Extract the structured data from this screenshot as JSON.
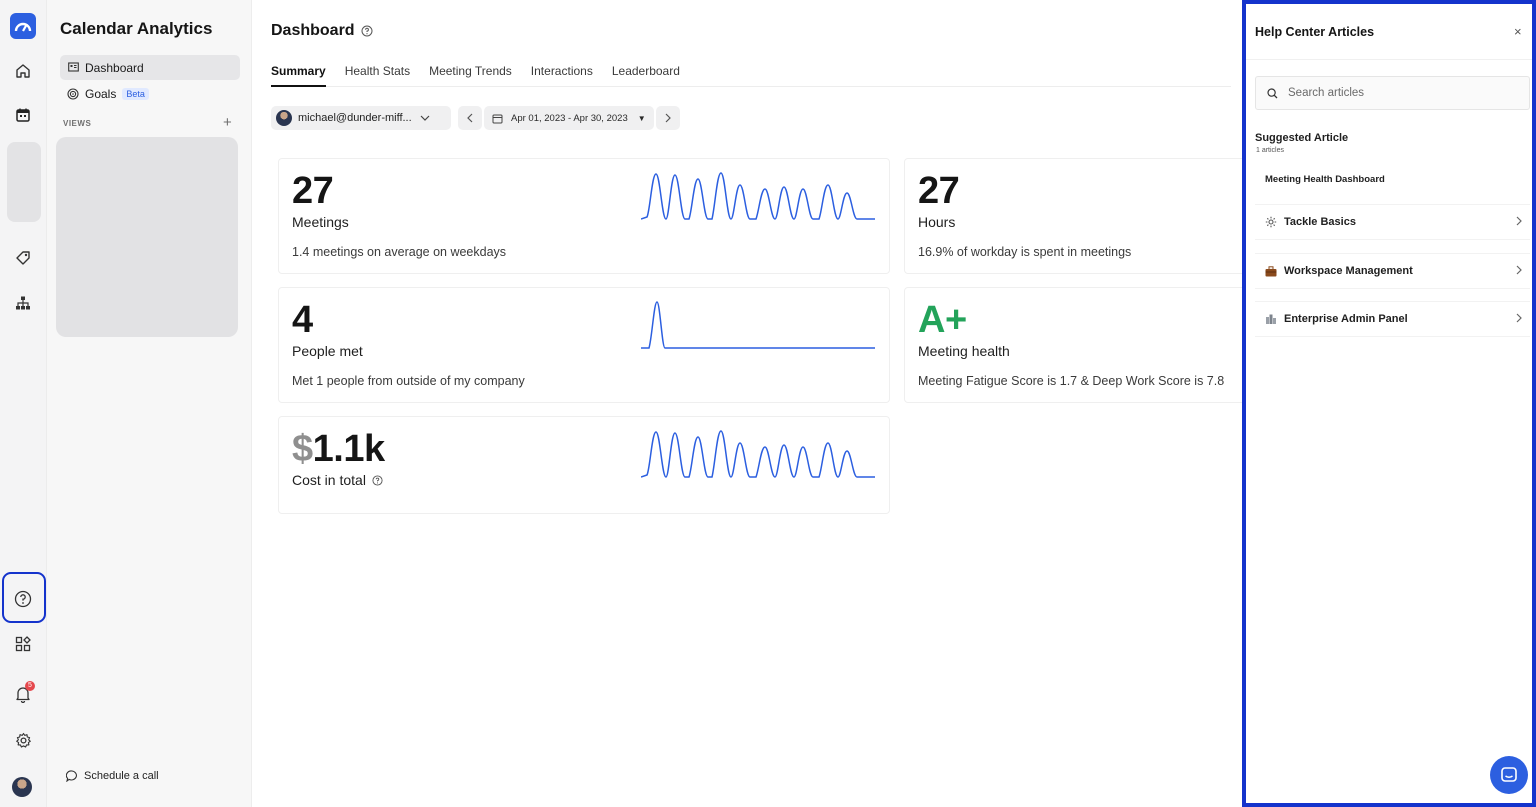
{
  "app": {
    "title": "Calendar Analytics"
  },
  "rail": {
    "notification_count": "5",
    "icons": [
      "logo-icon",
      "home-icon",
      "calendar-icon",
      "tag-icon",
      "org-chart-icon",
      "help-icon",
      "apps-icon",
      "bell-icon",
      "gear-icon",
      "avatar"
    ]
  },
  "nav": {
    "items": [
      {
        "label": "Dashboard",
        "icon": "dashboard-icon",
        "active": true
      },
      {
        "label": "Goals",
        "icon": "target-icon",
        "badge": "Beta"
      }
    ],
    "views_label": "VIEWS",
    "views_add": "+",
    "schedule_call": "Schedule a call"
  },
  "main": {
    "title": "Dashboard",
    "tabs": [
      {
        "label": "Summary",
        "active": true
      },
      {
        "label": "Health Stats"
      },
      {
        "label": "Meeting Trends"
      },
      {
        "label": "Interactions"
      },
      {
        "label": "Leaderboard"
      }
    ],
    "user_filter": "michael@dunder-miff...",
    "date_range": "Apr 01, 2023 - Apr 30, 2023",
    "cards": [
      {
        "value": "27",
        "label": "Meetings",
        "desc": "1.4 meetings on average on weekdays"
      },
      {
        "value": "27",
        "label": "Hours",
        "desc": "16.9% of workday is spent in meetings"
      },
      {
        "value": "4",
        "label": "People met",
        "desc": "Met 1 people from outside of my company"
      },
      {
        "value": "A+",
        "label": "Meeting health",
        "desc": "Meeting Fatigue Score is 1.7 & Deep Work Score is 7.8"
      },
      {
        "currency": "$",
        "value": "1.1k",
        "label": "Cost in total"
      }
    ]
  },
  "help": {
    "title": "Help Center Articles",
    "close": "×",
    "search_placeholder": "Search articles",
    "suggested_title": "Suggested Article",
    "suggested_count": "1 articles",
    "suggested_article": "Meeting Health Dashboard",
    "collections": [
      {
        "label": "Tackle Basics",
        "icon": "gear-icon"
      },
      {
        "label": "Workspace Management",
        "icon": "briefcase-icon"
      },
      {
        "label": "Enterprise Admin Panel",
        "icon": "building-icon"
      }
    ]
  },
  "colors": {
    "accent": "#2c5fe0",
    "highlight": "#1433cc",
    "green": "#23a35a"
  }
}
